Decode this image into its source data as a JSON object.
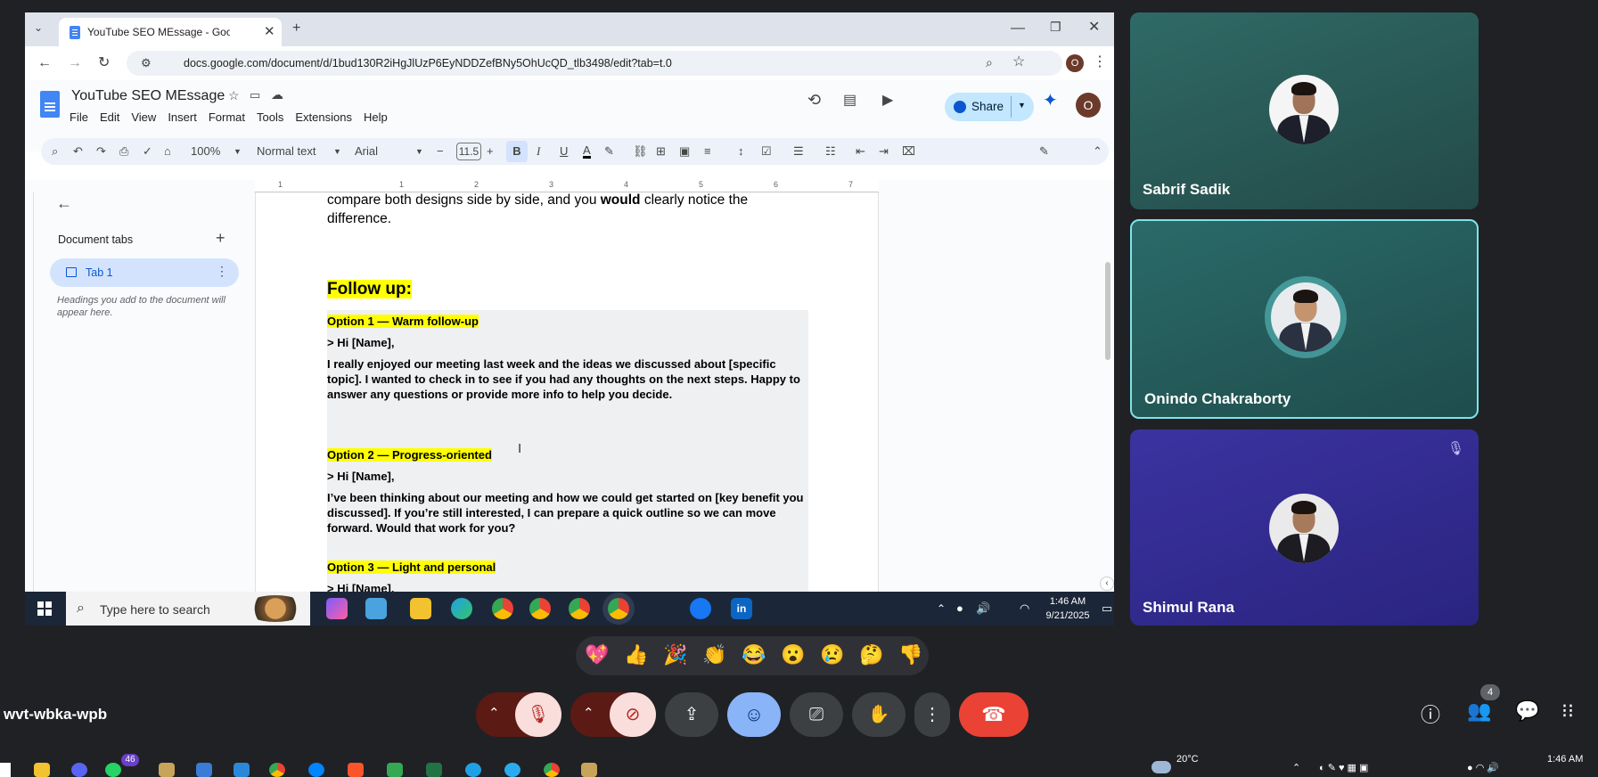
{
  "browser": {
    "tab_title": "YouTube SEO MEssage - Googl",
    "url": "docs.google.com/document/d/1bud130R2iHgJlUzP6EyNDDZefBNy5OhUcQD_tlb3498/edit?tab=t.0"
  },
  "docs": {
    "title": "YouTube SEO MEssage",
    "menu": [
      "File",
      "Edit",
      "View",
      "Insert",
      "Format",
      "Tools",
      "Extensions",
      "Help"
    ],
    "share_label": "Share",
    "avatar_letter": "O",
    "toolbar": {
      "zoom": "100%",
      "style": "Normal text",
      "font": "Arial",
      "font_size": "11.5",
      "bold": "B",
      "italic": "I",
      "underline": "U",
      "text_color": "A"
    },
    "ruler_numbers": [
      "1",
      "1",
      "2",
      "3",
      "4",
      "5",
      "6",
      "7"
    ],
    "sidebar": {
      "heading": "Document tabs",
      "tab_label": "Tab 1",
      "hint": "Headings you add to the document will appear here."
    },
    "content": {
      "intro_line1_a": "compare both designs side by side, and you ",
      "intro_bold": "would",
      "intro_line1_b": " clearly notice the",
      "intro_line2": "difference.",
      "follow_up": "Follow up:",
      "opt1_title": "Option 1 — Warm follow-up",
      "opt1_greet": "> Hi [Name],",
      "opt1_body": "I really enjoyed our meeting last week and the ideas we discussed about [specific topic]. I wanted to check in to see if you had any thoughts on the next steps. Happy to answer any questions or provide more info to help you decide.",
      "opt2_title": "Option 2 — Progress-oriented",
      "opt2_greet": "> Hi [Name],",
      "opt2_body": "I’ve been thinking about our meeting and how we could get started on [key benefit you discussed]. If you’re still interested, I can prepare a quick outline so we can move forward. Would that work for you?",
      "opt3_title": "Option 3 — Light and personal",
      "opt3_greet": "> Hi [Name],"
    }
  },
  "taskbar": {
    "search_placeholder": "Type here to search",
    "time": "1:46 AM",
    "date": "9/21/2025"
  },
  "participants": [
    {
      "name": "Sabrif Sadik",
      "bg": "#2c5a58"
    },
    {
      "name": "Onindo Chakraborty",
      "bg": "#245e5e"
    },
    {
      "name": "Shimul Rana",
      "bg": "#2f2a8a"
    }
  ],
  "reactions": [
    "💖",
    "👍",
    "🎉",
    "👏",
    "😂",
    "😮",
    "😢",
    "🤔",
    "👎"
  ],
  "meet": {
    "meeting_code": "wvt-wbka-wpb",
    "people_count": "4"
  },
  "os": {
    "weather": "20°C",
    "time": "1:46 AM",
    "badge": "46"
  },
  "colors": {
    "highlight": "#ffff00",
    "share_bg": "#c2e7ff",
    "end_call": "#ea4335",
    "active_speaker_border": "#7fe3e8"
  }
}
